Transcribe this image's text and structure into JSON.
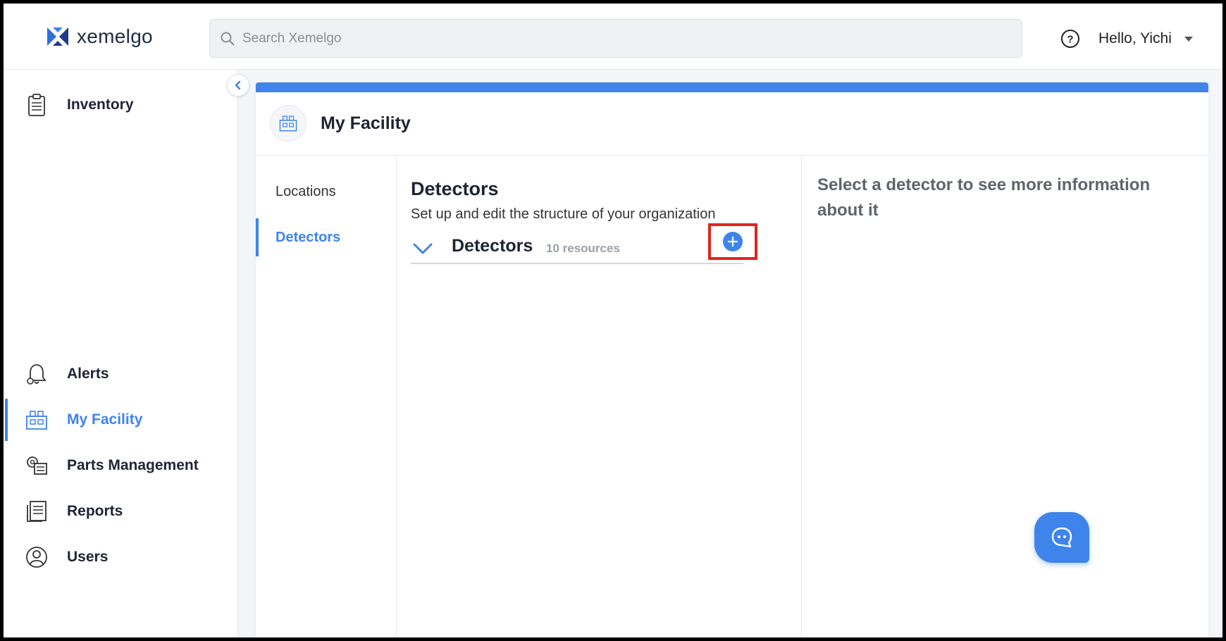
{
  "header": {
    "logo_text": "xemelgo",
    "search_placeholder": "Search Xemelgo",
    "greeting": "Hello, Yichi"
  },
  "sidebar": {
    "items": [
      {
        "label": "Inventory",
        "icon": "clipboard-icon"
      },
      {
        "label": "Alerts",
        "icon": "bell-icon"
      },
      {
        "label": "My Facility",
        "icon": "facility-icon",
        "active": true
      },
      {
        "label": "Parts Management",
        "icon": "parts-icon"
      },
      {
        "label": "Reports",
        "icon": "reports-icon"
      },
      {
        "label": "Users",
        "icon": "user-icon"
      }
    ]
  },
  "page": {
    "title": "My Facility",
    "subnav": [
      {
        "label": "Locations"
      },
      {
        "label": "Detectors",
        "active": true
      }
    ],
    "section_title": "Detectors",
    "section_subtitle": "Set up and edit the structure of your organization",
    "group": {
      "title": "Detectors",
      "count": "10 resources"
    },
    "detail_placeholder": "Select a detector to see more information about it"
  },
  "colors": {
    "accent": "#3f84ea",
    "highlight": "#e0261a"
  }
}
